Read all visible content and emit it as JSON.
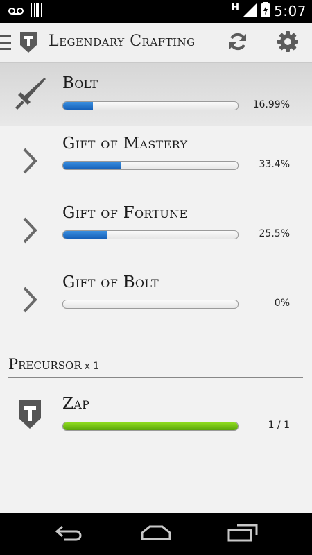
{
  "status_bar": {
    "time": "5:07",
    "network_letter": "H",
    "icons": [
      "voicemail-icon",
      "barcode-icon",
      "signal-icon",
      "battery-charging-icon"
    ]
  },
  "action_bar": {
    "title": "Legendary Crafting",
    "icons": [
      "menu-icon",
      "shield-logo-icon",
      "refresh-icon",
      "settings-icon"
    ]
  },
  "main_item": {
    "name": "Bolt",
    "percent_label": "16.99%",
    "progress": 0.1699,
    "icon": "sword-icon"
  },
  "gifts": [
    {
      "name": "Gift of Mastery",
      "percent_label": "33.4%",
      "progress": 0.334,
      "icon": "chevron-right-icon"
    },
    {
      "name": "Gift of Fortune",
      "percent_label": "25.5%",
      "progress": 0.255,
      "icon": "chevron-right-icon"
    },
    {
      "name": "Gift of Bolt",
      "percent_label": "0%",
      "progress": 0.0,
      "icon": "chevron-right-icon"
    }
  ],
  "precursor_section": {
    "title": "Precursor",
    "count": "x 1"
  },
  "precursor_item": {
    "name": "Zap",
    "count_label": "1 / 1",
    "progress": 1.0,
    "icon": "shield-icon"
  },
  "colors": {
    "progress_blue": "#1f6fc9",
    "progress_green": "#6bbf10",
    "selected_row": "#dcdcdc",
    "background": "#f2f2f2"
  },
  "nav_bar": {
    "icons": [
      "back-icon",
      "home-icon",
      "recent-apps-icon"
    ]
  }
}
